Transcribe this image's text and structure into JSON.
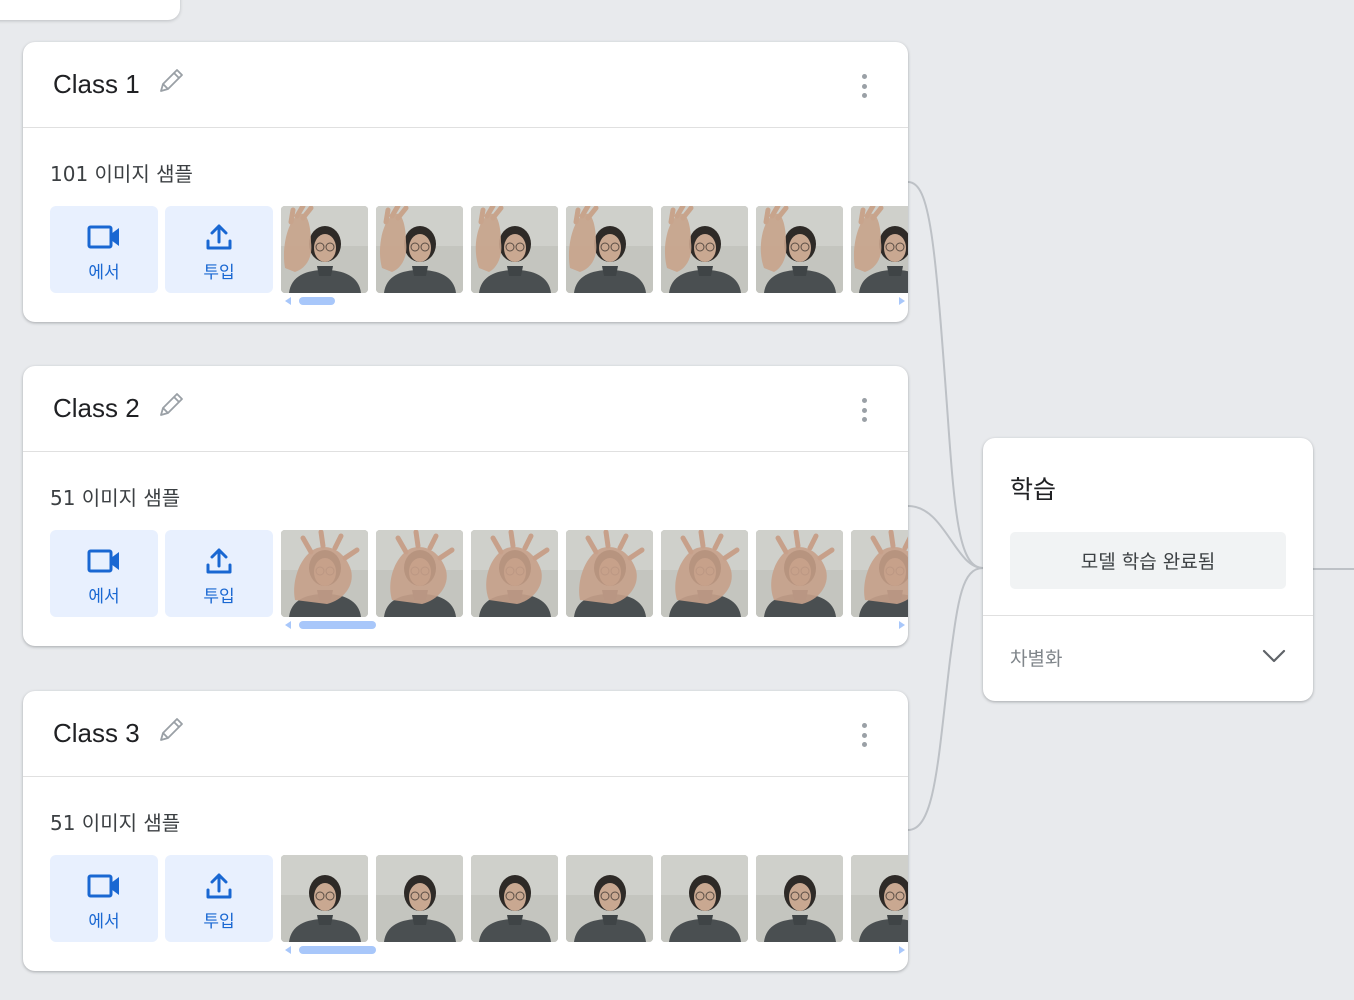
{
  "classes": [
    {
      "title": "Class 1",
      "sample_count": "101 이미지 샘플",
      "webcam_label": "에서",
      "upload_label": "투입",
      "thumb_kind": "hand",
      "thumb_count": 7,
      "scroll_fraction": 0.06
    },
    {
      "title": "Class 2",
      "sample_count": "51 이미지 샘플",
      "webcam_label": "에서",
      "upload_label": "투입",
      "thumb_kind": "hand_over_face",
      "thumb_count": 7,
      "scroll_fraction": 0.13
    },
    {
      "title": "Class 3",
      "sample_count": "51 이미지 샘플",
      "webcam_label": "에서",
      "upload_label": "투입",
      "thumb_kind": "face",
      "thumb_count": 7,
      "scroll_fraction": 0.13
    }
  ],
  "training": {
    "title": "학습",
    "button_label": "모델 학습 완료됨",
    "advanced_label": "차별화"
  },
  "icons": {
    "edit": "pencil-icon",
    "more": "more-vert-icon",
    "webcam": "videocam-icon",
    "upload": "upload-icon",
    "advanced": "chevron-down-icon"
  },
  "colors": {
    "background": "#e8eaed",
    "accent_blue": "#1967d2",
    "button_blue_bg": "#e8f0fe",
    "scrollbar": "#a8c7fa",
    "connector": "#bdc1c6"
  }
}
